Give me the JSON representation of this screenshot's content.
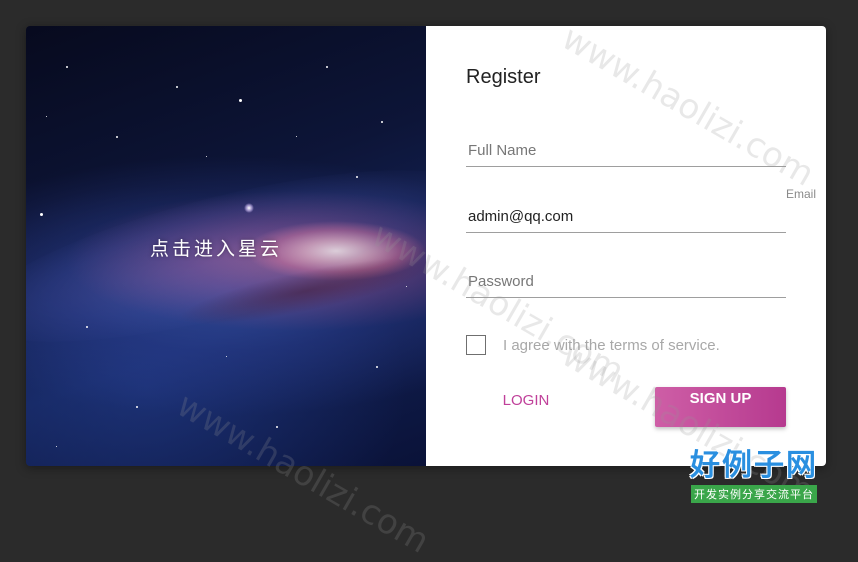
{
  "galaxy": {
    "caption": "点击进入星云"
  },
  "form": {
    "title": "Register",
    "full_name": {
      "placeholder": "Full Name",
      "value": ""
    },
    "email": {
      "label": "Email",
      "value": "admin@qq.com"
    },
    "password": {
      "placeholder": "Password",
      "value": ""
    },
    "terms_label": "I agree with the terms of service.",
    "terms_checked": false,
    "login_label": "LOGIN",
    "signup_label": "SIGN UP"
  },
  "watermark": {
    "text": "www.haolizi.com"
  },
  "brand": {
    "name": "好例子网",
    "tagline": "开发实例分享交流平台"
  },
  "colors": {
    "accent": "#c0409a",
    "button": "#bb4596",
    "background": "#2b2b2b",
    "brand_blue": "#2a8fe0",
    "brand_green": "#3aa64a"
  }
}
